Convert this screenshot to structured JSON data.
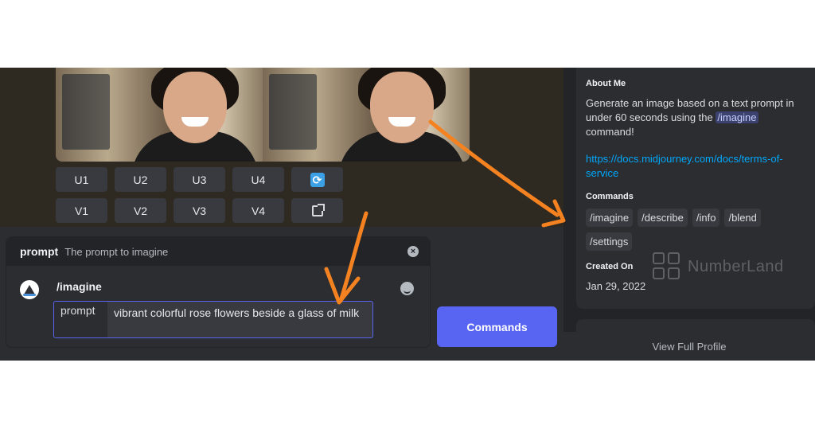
{
  "grid": {
    "upscale": [
      "U1",
      "U2",
      "U3",
      "U4"
    ],
    "variation": [
      "V1",
      "V2",
      "V3",
      "V4"
    ]
  },
  "prompt_card": {
    "option_name": "prompt",
    "option_description": "The prompt to imagine",
    "command": "/imagine",
    "field_label": "prompt",
    "field_value": "vibrant colorful rose flowers beside a glass of milk"
  },
  "commands_button": "Commands",
  "profile": {
    "about_title": "About Me",
    "about_text_before": "Generate an image based on a text prompt in under 60 seconds using the",
    "about_command": "/imagine",
    "about_text_after": "command!",
    "link": "https://docs.midjourney.com/docs/terms-of-service",
    "commands_title": "Commands",
    "commands": [
      "/imagine",
      "/describe",
      "/info",
      "/blend",
      "/settings"
    ],
    "created_title": "Created On",
    "created_date": "Jan 29, 2022",
    "view_full_profile": "View Full Profile"
  },
  "watermark": "NumberLand",
  "colors": {
    "annotation_arrow": "#f58220",
    "accent": "#5865f2",
    "link": "#00a8fc"
  },
  "icons": [
    "refresh-icon",
    "external-link-icon",
    "close-icon",
    "emoji-icon",
    "bot-avatar"
  ]
}
